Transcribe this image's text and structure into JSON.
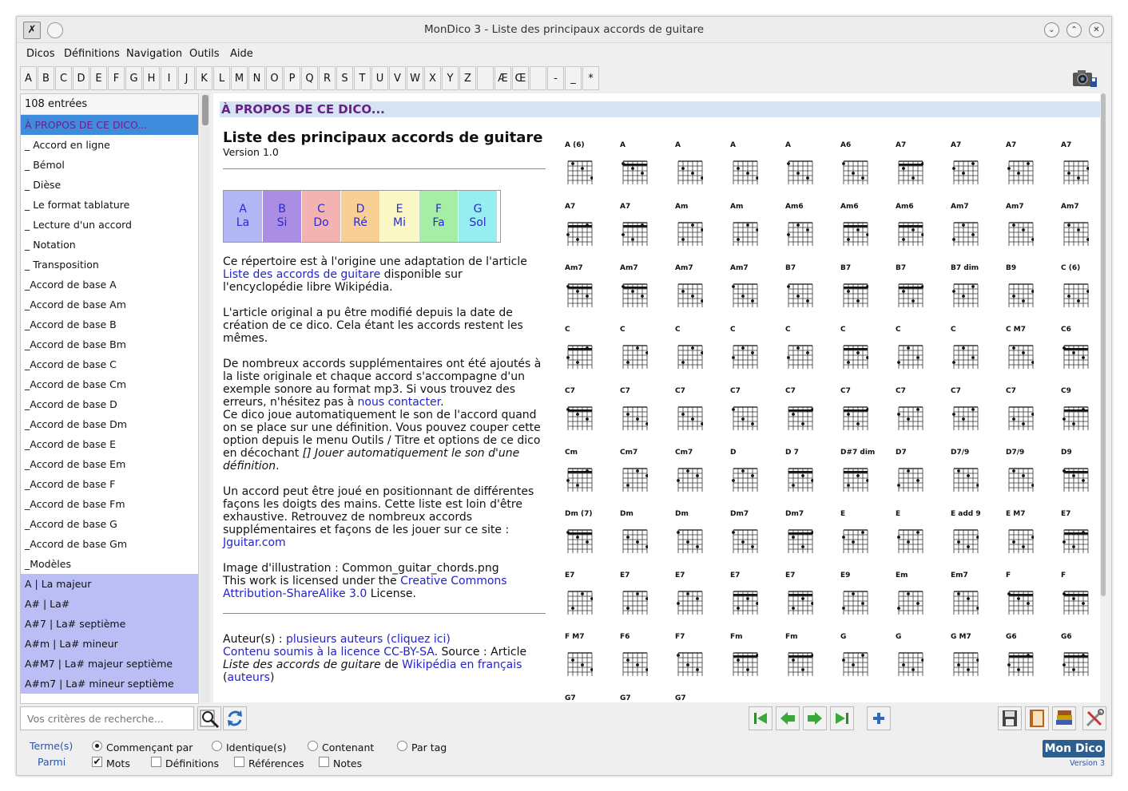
{
  "window": {
    "title": "MonDico 3 - Liste des principaux accords de guitare"
  },
  "menu": [
    "Dicos",
    "Définitions",
    "Navigation",
    "Outils",
    "Aide"
  ],
  "letters": [
    "A",
    "B",
    "C",
    "D",
    "E",
    "F",
    "G",
    "H",
    "I",
    "J",
    "K",
    "L",
    "M",
    "N",
    "O",
    "P",
    "Q",
    "R",
    "S",
    "T",
    "U",
    "V",
    "W",
    "X",
    "Y",
    "Z",
    " ",
    "Æ",
    "Œ",
    " ",
    "-",
    "_",
    "*"
  ],
  "sidebar": {
    "count": "108 entrées",
    "items": [
      {
        "label": "À PROPOS DE CE DICO...",
        "state": "selected"
      },
      {
        "label": "_ Accord en ligne",
        "state": ""
      },
      {
        "label": "_ Bémol",
        "state": ""
      },
      {
        "label": "_ Dièse",
        "state": ""
      },
      {
        "label": "_ Le format tablature",
        "state": ""
      },
      {
        "label": "_ Lecture d'un accord",
        "state": ""
      },
      {
        "label": "_ Notation",
        "state": ""
      },
      {
        "label": "_ Transposition",
        "state": ""
      },
      {
        "label": "_Accord de base A",
        "state": ""
      },
      {
        "label": "_Accord de base Am",
        "state": ""
      },
      {
        "label": "_Accord de base B",
        "state": ""
      },
      {
        "label": "_Accord de base Bm",
        "state": ""
      },
      {
        "label": "_Accord de base C",
        "state": ""
      },
      {
        "label": "_Accord de base Cm",
        "state": ""
      },
      {
        "label": "_Accord de base D",
        "state": ""
      },
      {
        "label": "_Accord de base Dm",
        "state": ""
      },
      {
        "label": "_Accord de base E",
        "state": ""
      },
      {
        "label": "_Accord de base Em",
        "state": ""
      },
      {
        "label": "_Accord de base F",
        "state": ""
      },
      {
        "label": "_Accord de base Fm",
        "state": ""
      },
      {
        "label": "_Accord de base G",
        "state": ""
      },
      {
        "label": "_Accord de base Gm",
        "state": ""
      },
      {
        "label": "_Modèles",
        "state": ""
      },
      {
        "label": "A | La majeur",
        "state": "highlight"
      },
      {
        "label": "A# | La#",
        "state": "highlight"
      },
      {
        "label": "A#7 | La# septième",
        "state": "highlight"
      },
      {
        "label": "A#m | La# mineur",
        "state": "highlight"
      },
      {
        "label": "A#M7 | La# majeur septième",
        "state": "highlight"
      },
      {
        "label": "A#m7 | La# mineur septième",
        "state": "highlight"
      }
    ]
  },
  "content": {
    "section_title": "À PROPOS DE CE DICO...",
    "doc_title": "Liste des principaux accords de guitare",
    "version": "Version 1.0",
    "notes": [
      {
        "letter": "A",
        "name": "La",
        "color": "#b3b6f4"
      },
      {
        "letter": "B",
        "name": "Si",
        "color": "#a98ee4"
      },
      {
        "letter": "C",
        "name": "Do",
        "color": "#f4b3b3"
      },
      {
        "letter": "D",
        "name": "Ré",
        "color": "#f8cf95"
      },
      {
        "letter": "E",
        "name": "Mi",
        "color": "#fbf8c5"
      },
      {
        "letter": "F",
        "name": "Fa",
        "color": "#a6eea6"
      },
      {
        "letter": "G",
        "name": "Sol",
        "color": "#97eef0"
      }
    ],
    "p1_a": "Ce répertoire est à l'origine une adaptation de l'article ",
    "p1_link": "Liste des accords de guitare",
    "p1_b": " disponible sur l'encyclopédie libre Wikipédia.",
    "p2": "L'article original a pu être modifié depuis la date de création de ce dico. Cela étant les accords restent les mêmes.",
    "p3_a": "De nombreux accords supplémentaires ont été ajoutés à la liste originale et chaque accord s'accompagne d'un exemple sonore au format mp3. Si vous trouvez des erreurs, n'hésitez pas à ",
    "p3_link": "nous contacter",
    "p3_b": ".",
    "p4_a": "Ce dico joue automatiquement le son de l'accord quand on se place sur une définition. Vous pouvez couper cette option depuis le menu Outils / Titre et options de ce dico en décochant ",
    "p4_ital": "[] Jouer automatiquement le son d'une définition",
    "p4_b": ".",
    "p5_a": "Un accord peut être joué en positionnant de différentes façons les doigts des mains. Cette liste est loin d'être exhaustive. Retrouvez de nombreux accords supplémentaires et façons de les jouer sur ce site : ",
    "p5_link": "Jguitar.com",
    "p6_a": "Image d'illustration : Common_guitar_chords.png",
    "p6_b": "This work is licensed under the ",
    "p6_link": "Creative Commons Attribution-ShareAlike 3.0",
    "p6_c": " License.",
    "p7_a": "Auteur(s) : ",
    "p7_link1": "plusieurs auteurs (cliquez ici)",
    "p7_link2": "Contenu soumis à la licence CC-BY-SA",
    "p7_b": ". Source : Article ",
    "p7_ital": "Liste des accords de guitare",
    "p7_c": " de ",
    "p7_link3": "Wikipédia en français",
    "p7_d": " (",
    "p7_link4": "auteurs",
    "p7_e": ")"
  },
  "chord_image": {
    "names": [
      "A (6)",
      "A",
      "A",
      "A",
      "A",
      "A6",
      "A7",
      "A7",
      "A7",
      "A7",
      "A7",
      "A7",
      "Am",
      "Am",
      "Am6",
      "Am6",
      "Am6",
      "Am7",
      "Am7",
      "Am7",
      "Am7",
      "Am7",
      "Am7",
      "Am7",
      "B7",
      "B7",
      "B7",
      "B7 dim",
      "B9",
      "C (6)",
      "C",
      "C",
      "C",
      "C",
      "C",
      "C",
      "C",
      "C",
      "C M7",
      "C6",
      "C7",
      "C7",
      "C7",
      "C7",
      "C7",
      "C7",
      "C7",
      "C7",
      "C7",
      "C9",
      "Cm",
      "Cm7",
      "Cm7",
      "D",
      "D 7",
      "D#7 dim",
      "D7",
      "D7/9",
      "D7/9",
      "D9",
      "Dm (7)",
      "Dm",
      "Dm",
      "Dm7",
      "Dm7",
      "E",
      "E",
      "E add 9",
      "E M7",
      "E7",
      "E7",
      "E7",
      "E7",
      "E7",
      "E7",
      "E9",
      "Em",
      "Em7",
      "F",
      "F",
      "F M7",
      "F6",
      "F7",
      "Fm",
      "Fm",
      "G",
      "G",
      "G M7",
      "G6",
      "G6",
      "G7",
      "G7",
      "G7"
    ]
  },
  "search": {
    "placeholder": "Vos critères de recherche..."
  },
  "options": {
    "termes_label": "Terme(s)",
    "parmi_label": "Parmi",
    "radios": [
      "Commençant par",
      "Identique(s)",
      "Contenant",
      "Par tag"
    ],
    "checks": [
      "Mots",
      "Définitions",
      "Références",
      "Notes"
    ]
  },
  "logo": {
    "text": "Mon Dico",
    "version": "Version 3"
  }
}
